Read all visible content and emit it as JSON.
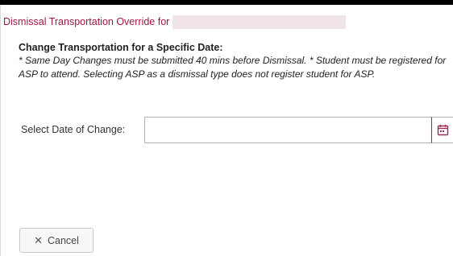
{
  "dialog": {
    "title": "Dismissal Transportation Override for",
    "student_name_redacted": true
  },
  "section": {
    "heading": "Change Transportation for a Specific Date:",
    "note": "* Same Day Changes must be submitted 40 mins before Dismissal. * Student must be registered for ASP to attend. Selecting ASP as a dismissal type does not register student for ASP."
  },
  "form": {
    "date_label": "Select Date of Change:",
    "date_value": "",
    "calendar_icon": "calendar-icon"
  },
  "actions": {
    "cancel_icon": "close-icon",
    "cancel_glyph": "✕",
    "cancel_label": "Cancel"
  },
  "colors": {
    "title": "#a3163f",
    "accent": "#9b2b55",
    "redaction": "#f0e4ea"
  }
}
